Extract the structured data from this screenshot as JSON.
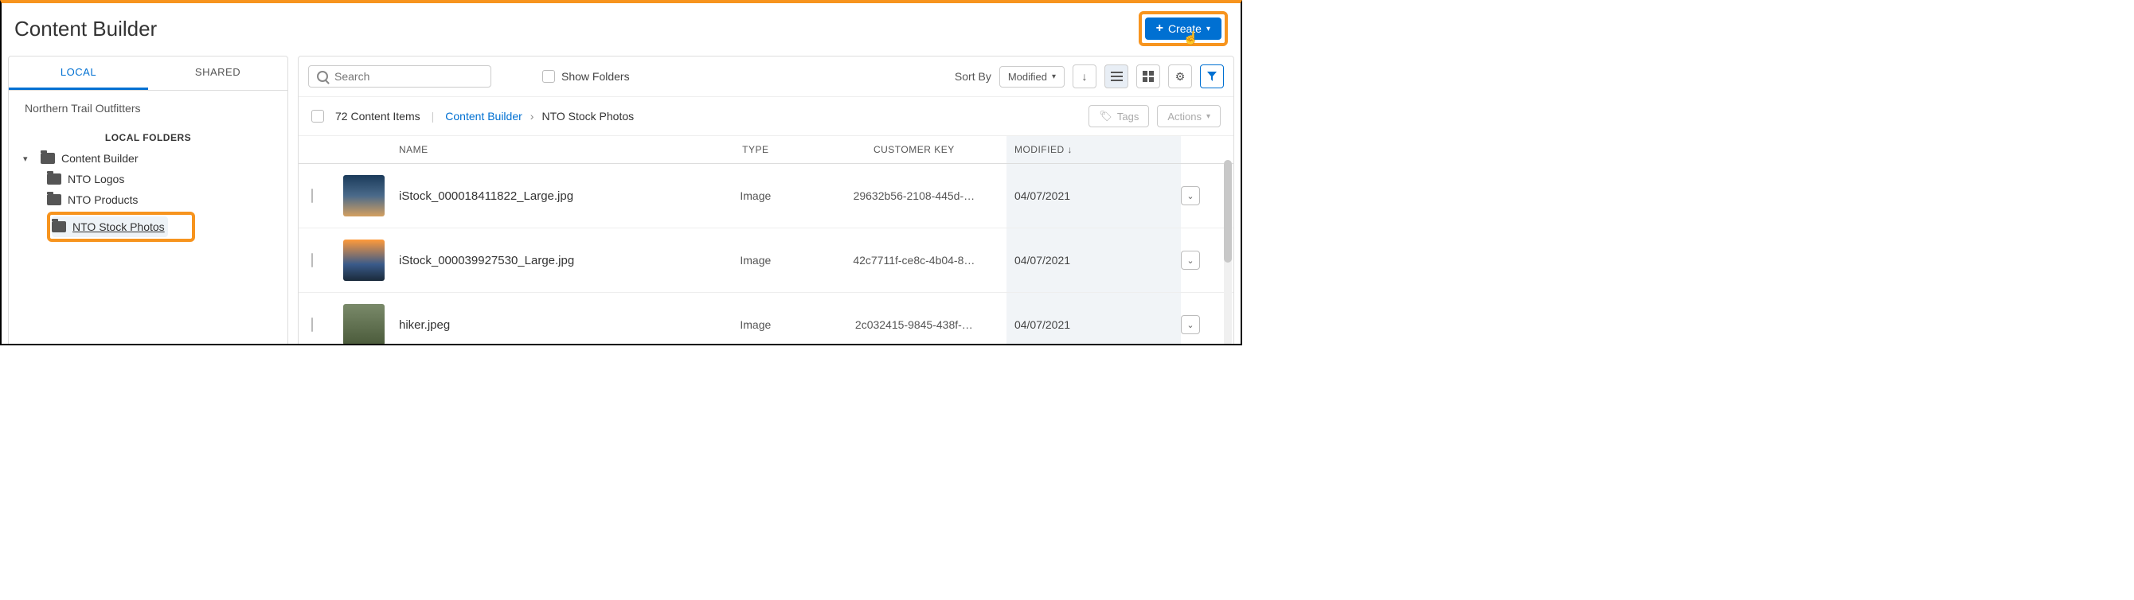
{
  "header": {
    "title": "Content Builder",
    "create_label": "Create"
  },
  "sidebar": {
    "tabs": {
      "local": "LOCAL",
      "shared": "SHARED"
    },
    "org": "Northern Trail Outfitters",
    "folders_heading": "LOCAL FOLDERS",
    "root": "Content Builder",
    "children": [
      {
        "label": "NTO Logos"
      },
      {
        "label": "NTO Products"
      },
      {
        "label": "NTO Stock Photos"
      }
    ]
  },
  "toolbar": {
    "search_placeholder": "Search",
    "show_folders": "Show Folders",
    "sort_by_label": "Sort By",
    "sort_value": "Modified"
  },
  "subheader": {
    "count_text": "72 Content Items",
    "breadcrumb_root": "Content Builder",
    "breadcrumb_current": "NTO Stock Photos",
    "tags_btn": "Tags",
    "actions_btn": "Actions"
  },
  "columns": {
    "name": "NAME",
    "type": "TYPE",
    "key": "CUSTOMER KEY",
    "modified": "MODIFIED"
  },
  "rows": [
    {
      "name": "iStock_000018411822_Large.jpg",
      "type": "Image",
      "key": "29632b56-2108-445d-…",
      "modified": "04/07/2021"
    },
    {
      "name": "iStock_000039927530_Large.jpg",
      "type": "Image",
      "key": "42c7711f-ce8c-4b04-8…",
      "modified": "04/07/2021"
    },
    {
      "name": "hiker.jpeg",
      "type": "Image",
      "key": "2c032415-9845-438f-…",
      "modified": "04/07/2021"
    }
  ]
}
